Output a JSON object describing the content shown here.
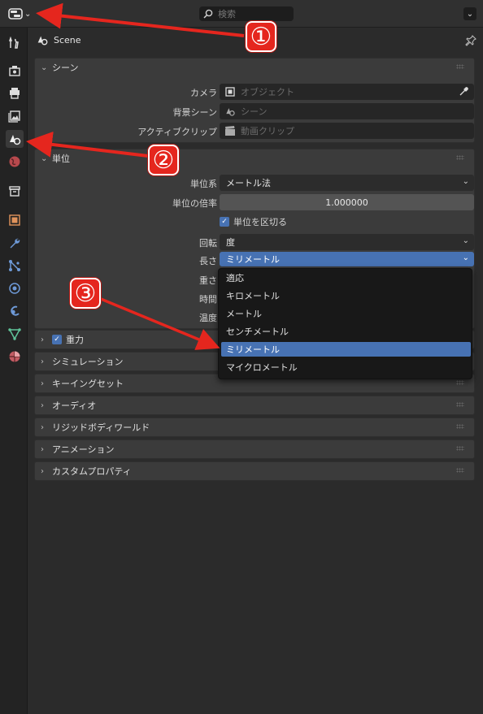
{
  "header": {
    "search_placeholder": "検索",
    "icons": [
      "editor-type-icon",
      "search-icon",
      "chevron-down-icon"
    ]
  },
  "sidebar": {
    "items": [
      {
        "name": "tool-tab",
        "icon": "wrench-screwdriver-icon"
      },
      {
        "name": "render-tab",
        "icon": "camera-back-icon"
      },
      {
        "name": "output-tab",
        "icon": "printer-icon"
      },
      {
        "name": "view-layer-tab",
        "icon": "image-stack-icon"
      },
      {
        "name": "scene-tab",
        "icon": "scene-icon",
        "active": true
      },
      {
        "name": "world-tab",
        "icon": "world-icon"
      },
      {
        "name": "collection-tab",
        "icon": "box-icon"
      },
      {
        "name": "object-tab",
        "icon": "orange-square-icon"
      },
      {
        "name": "modifier-tab",
        "icon": "wrench-icon"
      },
      {
        "name": "particles-tab",
        "icon": "particles-icon"
      },
      {
        "name": "physics-tab",
        "icon": "physics-icon"
      },
      {
        "name": "constraints-tab",
        "icon": "constraint-icon"
      },
      {
        "name": "data-tab",
        "icon": "mesh-data-icon"
      },
      {
        "name": "material-tab",
        "icon": "material-icon"
      }
    ]
  },
  "panel": {
    "title": "Scene"
  },
  "scene_section": {
    "title": "シーン",
    "camera_label": "カメラ",
    "camera_placeholder": "オブジェクト",
    "bg_scene_label": "背景シーン",
    "bg_scene_placeholder": "シーン",
    "active_clip_label": "アクティブクリップ",
    "active_clip_placeholder": "動画クリップ"
  },
  "units_section": {
    "title": "単位",
    "unit_system_label": "単位系",
    "unit_system_value": "メートル法",
    "unit_scale_label": "単位の倍率",
    "unit_scale_value": "1.000000",
    "separate_units_label": "単位を区切る",
    "separate_units_checked": true,
    "rotation_label": "回転",
    "rotation_value": "度",
    "length_label": "長さ",
    "length_value": "ミリメートル",
    "mass_label": "重さ",
    "time_label": "時間",
    "temperature_label": "温度"
  },
  "length_menu": {
    "options": [
      "適応",
      "キロメートル",
      "メートル",
      "センチメートル",
      "ミリメートル",
      "マイクロメートル"
    ],
    "selected": "ミリメートル"
  },
  "collapsed_sections": [
    {
      "title": "重力",
      "checkbox": true
    },
    {
      "title": "シミュレーション"
    },
    {
      "title": "キーイングセット"
    },
    {
      "title": "オーディオ"
    },
    {
      "title": "リジッドボディワールド"
    },
    {
      "title": "アニメーション"
    },
    {
      "title": "カスタムプロパティ"
    }
  ],
  "annotations": [
    "①",
    "②",
    "③"
  ],
  "colors": {
    "accent": "#4772b3",
    "annotation": "#e5261e"
  }
}
